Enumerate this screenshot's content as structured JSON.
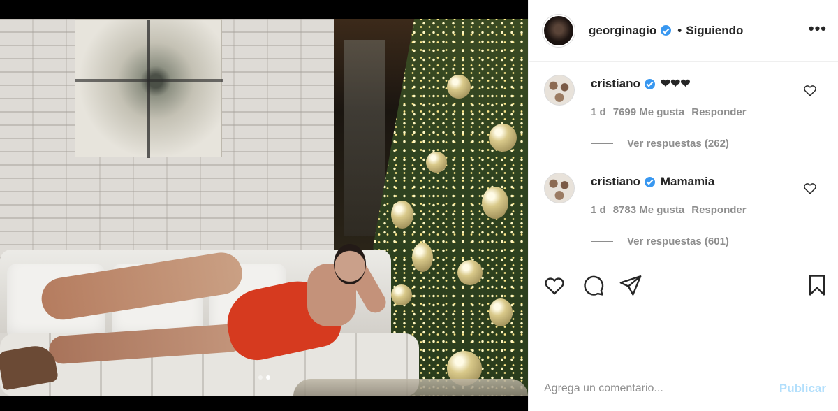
{
  "post": {
    "username": "georginagio",
    "separator": "•",
    "follow_status": "Siguiendo",
    "more_icon": "more-horizontal-icon",
    "more_glyph": "•••",
    "carousel": {
      "slide_count": 2,
      "active_slide": 2
    }
  },
  "comments": [
    {
      "username": "cristiano",
      "text": "❤❤❤",
      "age": "1 d",
      "likes": "7699 Me gusta",
      "reply_label": "Responder",
      "replies_label": "Ver respuestas (262)"
    },
    {
      "username": "cristiano",
      "text": "Mamamia",
      "age": "1 d",
      "likes": "8783 Me gusta",
      "reply_label": "Responder",
      "replies_label": "Ver respuestas (601)"
    }
  ],
  "actions": {
    "like_icon": "heart-icon",
    "comment_icon": "comment-bubble-icon",
    "share_icon": "paper-plane-icon",
    "save_icon": "bookmark-icon"
  },
  "add_comment": {
    "placeholder": "Agrega un comentario...",
    "publish_label": "Publicar"
  },
  "colors": {
    "verified": "#3897f0",
    "publish_disabled": "#b2dffc",
    "muted_text": "#8e8e8e",
    "divider": "#efefef"
  }
}
